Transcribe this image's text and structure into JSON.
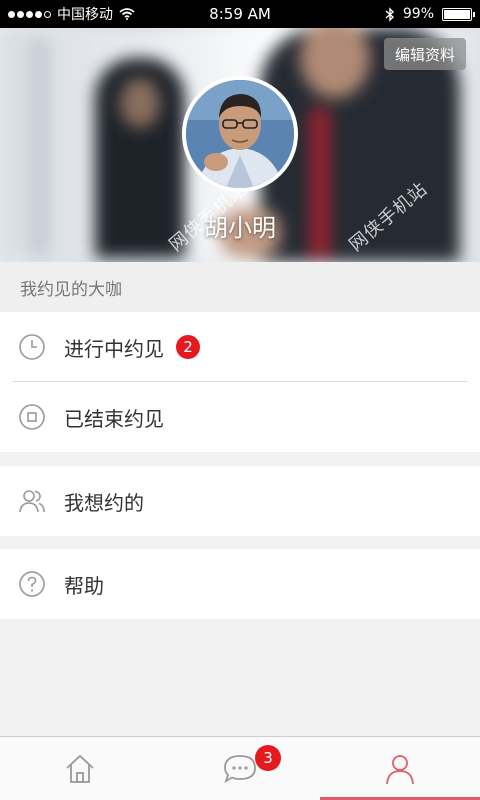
{
  "status_bar": {
    "carrier": "中国移动",
    "time": "8:59 AM",
    "battery": "99%",
    "battery_level": 0.99,
    "icons": [
      "signal-icon",
      "wifi-icon",
      "bluetooth-icon",
      "battery-icon"
    ]
  },
  "header": {
    "edit_label": "编辑资料",
    "username": "胡小明",
    "watermark": "网侠手机站"
  },
  "section_title": "我约见的大咖",
  "menu": {
    "ongoing": {
      "label": "进行中约见",
      "badge": "2",
      "icon": "clock-icon"
    },
    "ended": {
      "label": "已结束约见",
      "icon": "stop-icon"
    },
    "wanted": {
      "label": "我想约的",
      "icon": "people-icon"
    },
    "help": {
      "label": "帮助",
      "icon": "question-icon"
    }
  },
  "tabbar": {
    "tabs": [
      {
        "name": "home",
        "icon": "home-icon"
      },
      {
        "name": "messages",
        "icon": "chat-icon",
        "badge": "3"
      },
      {
        "name": "profile",
        "icon": "user-icon",
        "active": true
      }
    ]
  },
  "colors": {
    "badge": "#e6191e",
    "accent": "#e05d6a",
    "icon": "#999999"
  }
}
